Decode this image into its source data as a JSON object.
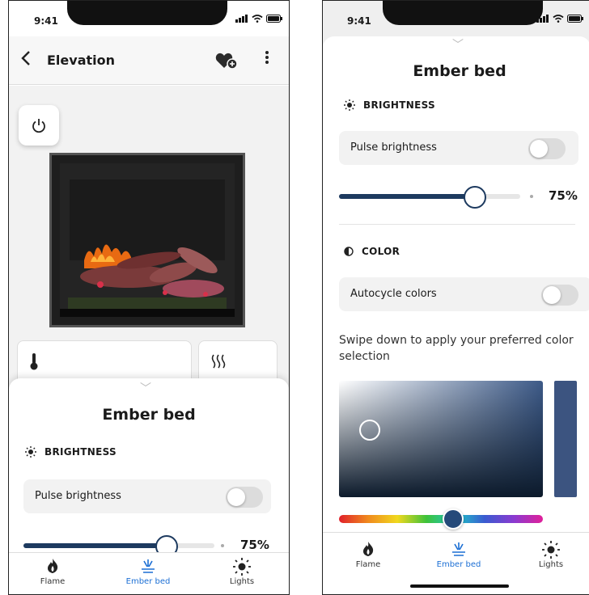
{
  "status": {
    "time": "9:41"
  },
  "header": {
    "title": "Elevation"
  },
  "sheet": {
    "handle": "﹀",
    "title": "Ember bed",
    "brightness": {
      "section_label": "BRIGHTNESS",
      "pulse_label": "Pulse brightness",
      "pulse_on": false,
      "value_label": "75%",
      "value": 0.75
    },
    "color": {
      "section_label": "COLOR",
      "autocycle_label": "Autocycle colors",
      "autocycle_on": false,
      "hint": "Swipe down to apply your preferred color selection",
      "selected_color": "#3c5480"
    }
  },
  "tabs": [
    {
      "label": "Flame",
      "icon": "flame-icon",
      "active": false
    },
    {
      "label": "Ember bed",
      "icon": "ember-bed-icon",
      "active": true
    },
    {
      "label": "Lights",
      "icon": "sun-icon",
      "active": false
    }
  ],
  "colors": {
    "accent": "#1c6fd4",
    "slider": "#1d3a5f"
  }
}
